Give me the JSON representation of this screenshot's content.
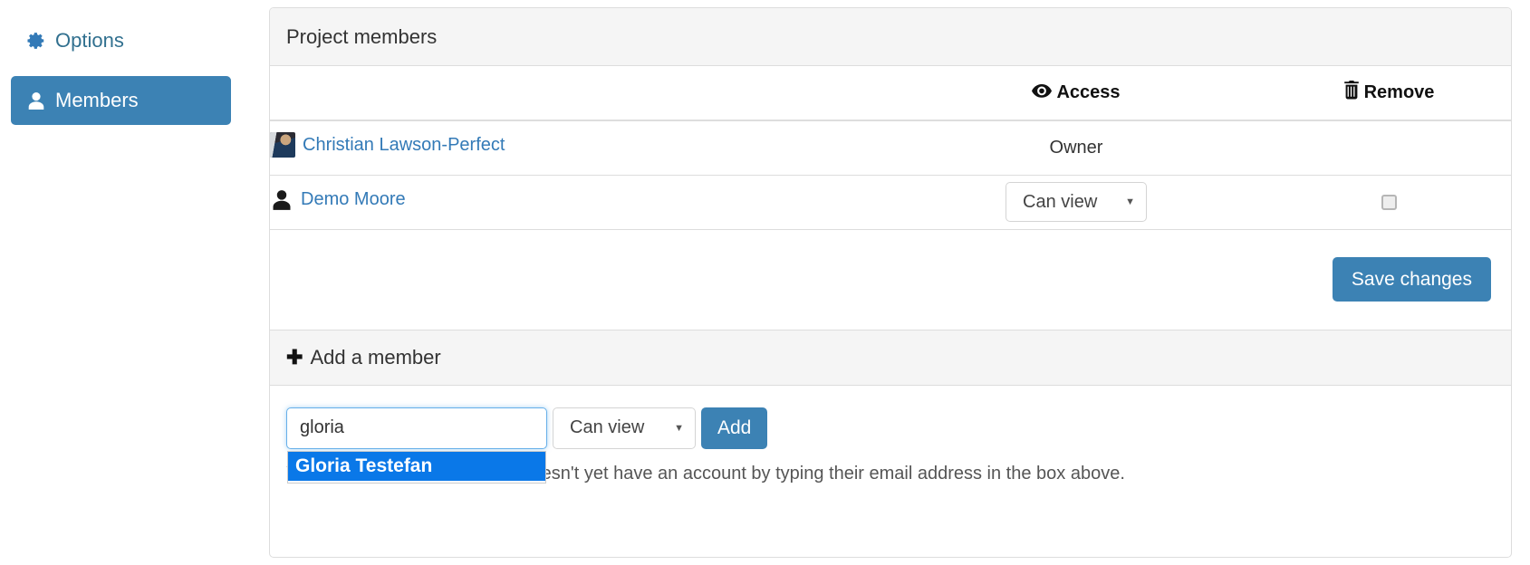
{
  "sidebar": {
    "items": [
      {
        "label": "Options",
        "icon": "gear-icon",
        "active": false
      },
      {
        "label": "Members",
        "icon": "user-icon",
        "active": true
      }
    ]
  },
  "panel": {
    "title": "Project members",
    "table": {
      "columns": [
        {
          "key": "name",
          "label": ""
        },
        {
          "key": "access",
          "label": "Access",
          "icon": "eye-icon"
        },
        {
          "key": "remove",
          "label": "Remove",
          "icon": "trash-icon"
        }
      ],
      "rows": [
        {
          "name": "Christian Lawson-Perfect",
          "avatar": "profile-photo",
          "access_type": "text",
          "access_value": "Owner",
          "remove": false
        },
        {
          "name": "Demo Moore",
          "avatar": "user-glyph",
          "access_type": "select",
          "access_value": "Can view",
          "remove": true,
          "remove_checked": false
        }
      ]
    },
    "save_label": "Save changes"
  },
  "add_member": {
    "heading": "Add a member",
    "plus_icon": "plus-icon",
    "search": {
      "value": "gloria",
      "placeholder": ""
    },
    "autocomplete": {
      "items": [
        {
          "label": "Gloria Testefan",
          "selected": true
        }
      ]
    },
    "access_value": "Can view",
    "add_label": "Add",
    "help_text": "You can invite someone who doesn't yet have an account by typing their email address in the box above."
  },
  "colors": {
    "brand": "#3c82b4",
    "link": "#337ab7",
    "highlight": "#0a78e8",
    "panel_head": "#f5f5f5",
    "border": "#dddddd"
  }
}
